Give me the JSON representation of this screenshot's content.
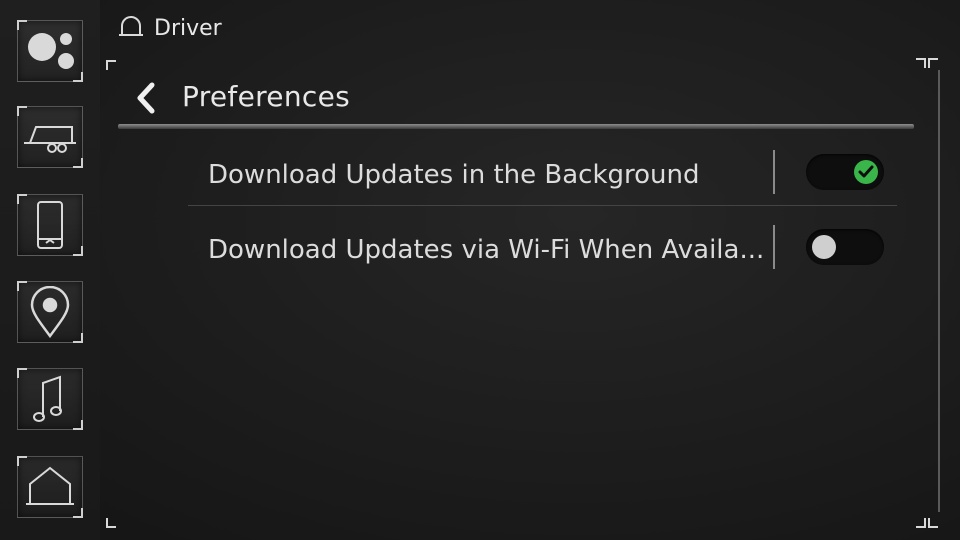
{
  "header": {
    "profile_label": "Driver"
  },
  "page": {
    "title": "Preferences"
  },
  "settings": [
    {
      "label": "Download Updates in the Background",
      "enabled": true
    },
    {
      "label": "Download Updates via Wi-Fi When Availa...",
      "enabled": false
    }
  ],
  "sidebar": {
    "items": [
      {
        "icon": "apps-bubbles-icon"
      },
      {
        "icon": "trailer-icon"
      },
      {
        "icon": "phone-icon"
      },
      {
        "icon": "location-pin-icon"
      },
      {
        "icon": "music-note-icon"
      },
      {
        "icon": "home-icon"
      }
    ]
  },
  "colors": {
    "accent_on": "#3ab54a",
    "knob_off": "#cfcfcf"
  }
}
